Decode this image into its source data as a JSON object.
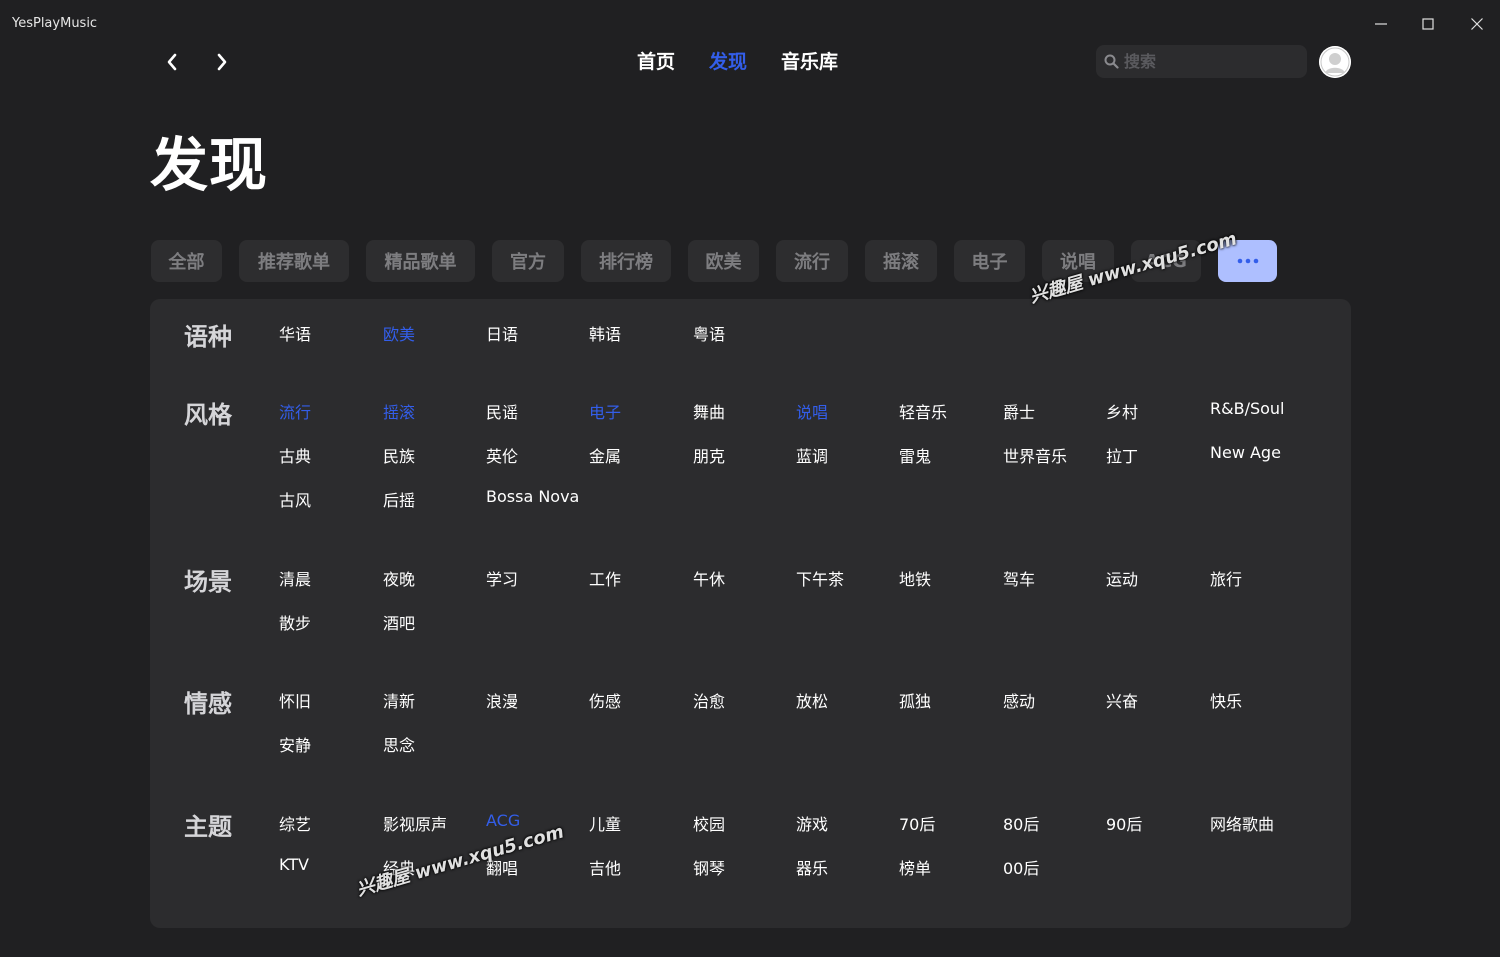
{
  "window": {
    "title": "YesPlayMusic"
  },
  "nav": {
    "links": [
      {
        "label": "首页",
        "active": false
      },
      {
        "label": "发现",
        "active": true
      },
      {
        "label": "音乐库",
        "active": false
      }
    ],
    "search_placeholder": "搜索"
  },
  "page": {
    "title": "发现"
  },
  "chips": [
    "全部",
    "推荐歌单",
    "精品歌单",
    "官方",
    "排行榜",
    "欧美",
    "流行",
    "摇滚",
    "电子",
    "说唱",
    "ACG"
  ],
  "more_chip": "...",
  "categories": [
    {
      "title": "语种",
      "rows": [
        [
          {
            "label": "华语"
          },
          {
            "label": "欧美",
            "active": true
          },
          {
            "label": "日语"
          },
          {
            "label": "韩语"
          },
          {
            "label": "粤语"
          }
        ]
      ]
    },
    {
      "title": "风格",
      "rows": [
        [
          {
            "label": "流行",
            "active": true
          },
          {
            "label": "摇滚",
            "active": true
          },
          {
            "label": "民谣"
          },
          {
            "label": "电子",
            "active": true
          },
          {
            "label": "舞曲"
          },
          {
            "label": "说唱",
            "active": true
          },
          {
            "label": "轻音乐"
          },
          {
            "label": "爵士"
          },
          {
            "label": "乡村"
          },
          {
            "label": "R&B/Soul"
          }
        ],
        [
          {
            "label": "古典"
          },
          {
            "label": "民族"
          },
          {
            "label": "英伦"
          },
          {
            "label": "金属"
          },
          {
            "label": "朋克"
          },
          {
            "label": "蓝调"
          },
          {
            "label": "雷鬼"
          },
          {
            "label": "世界音乐"
          },
          {
            "label": "拉丁"
          },
          {
            "label": "New Age"
          }
        ],
        [
          {
            "label": "古风"
          },
          {
            "label": "后摇"
          },
          {
            "label": "Bossa Nova"
          }
        ]
      ]
    },
    {
      "title": "场景",
      "rows": [
        [
          {
            "label": "清晨"
          },
          {
            "label": "夜晚"
          },
          {
            "label": "学习"
          },
          {
            "label": "工作"
          },
          {
            "label": "午休"
          },
          {
            "label": "下午茶"
          },
          {
            "label": "地铁"
          },
          {
            "label": "驾车"
          },
          {
            "label": "运动"
          },
          {
            "label": "旅行"
          }
        ],
        [
          {
            "label": "散步"
          },
          {
            "label": "酒吧"
          }
        ]
      ]
    },
    {
      "title": "情感",
      "rows": [
        [
          {
            "label": "怀旧"
          },
          {
            "label": "清新"
          },
          {
            "label": "浪漫"
          },
          {
            "label": "伤感"
          },
          {
            "label": "治愈"
          },
          {
            "label": "放松"
          },
          {
            "label": "孤独"
          },
          {
            "label": "感动"
          },
          {
            "label": "兴奋"
          },
          {
            "label": "快乐"
          }
        ],
        [
          {
            "label": "安静"
          },
          {
            "label": "思念"
          }
        ]
      ]
    },
    {
      "title": "主题",
      "rows": [
        [
          {
            "label": "综艺"
          },
          {
            "label": "影视原声"
          },
          {
            "label": "ACG",
            "active": true
          },
          {
            "label": "儿童"
          },
          {
            "label": "校园"
          },
          {
            "label": "游戏"
          },
          {
            "label": "70后"
          },
          {
            "label": "80后"
          },
          {
            "label": "90后"
          },
          {
            "label": "网络歌曲"
          }
        ],
        [
          {
            "label": "KTV"
          },
          {
            "label": "经典"
          },
          {
            "label": "翻唱"
          },
          {
            "label": "吉他"
          },
          {
            "label": "钢琴"
          },
          {
            "label": "器乐"
          },
          {
            "label": "榜单"
          },
          {
            "label": "00后"
          }
        ]
      ]
    }
  ],
  "watermarks": [
    "兴趣屋 www.xqu5.com",
    "兴趣屋 www.xqu5.com"
  ],
  "colors": {
    "accent": "#335eea",
    "background": "#202022",
    "panel": "#2c2c2e",
    "chip": "#2d2d2f",
    "chip_text": "#7d7d80",
    "more_chip": "#aebfff"
  }
}
